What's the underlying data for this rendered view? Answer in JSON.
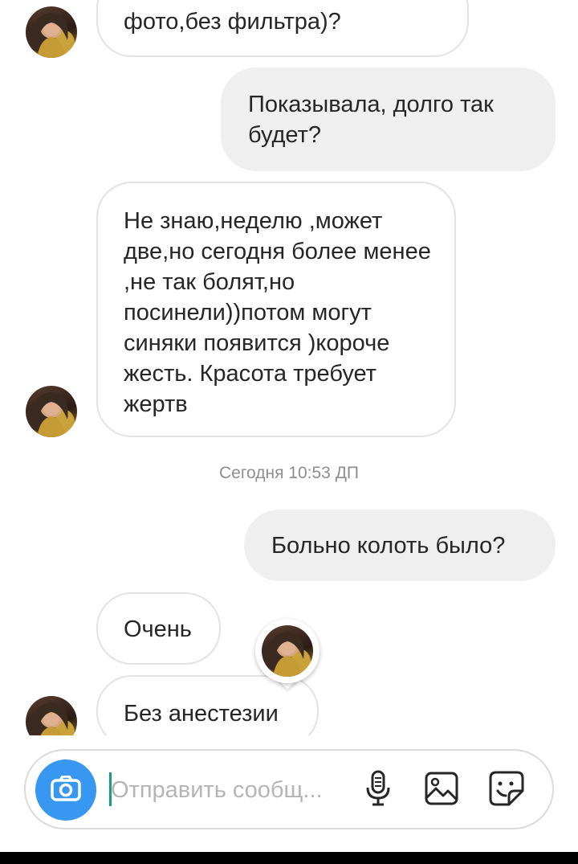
{
  "messages": [
    {
      "id": "m1",
      "side": "in",
      "text": "тебе мама не показывала фото,без фильтра)?"
    },
    {
      "id": "m2",
      "side": "out",
      "text": "Показывала, долго так будет?"
    },
    {
      "id": "m3",
      "side": "in",
      "text": "Не знаю,неделю ,может две,но сегодня более менее ,не так болят,но посинели))потом могут синяки появится )короче жесть. Красота требует жертв"
    },
    {
      "id": "m4",
      "side": "out",
      "text": "Больно колоть было?"
    },
    {
      "id": "m5",
      "side": "in",
      "text": "Очень"
    },
    {
      "id": "m6",
      "side": "in",
      "text": "Без анестезии"
    }
  ],
  "timestamp": "Сегодня 10:53 ДП",
  "composer": {
    "placeholder": "Отправить сообщ...",
    "icons": [
      "camera-icon",
      "microphone-icon",
      "gallery-icon",
      "sticker-icon"
    ]
  },
  "colors": {
    "accent": "#3897f0",
    "outgoing_bubble": "#efefef",
    "incoming_border": "#e3e3e3",
    "timestamp": "#8e8e8e",
    "cursor": "#1a9b7a"
  }
}
